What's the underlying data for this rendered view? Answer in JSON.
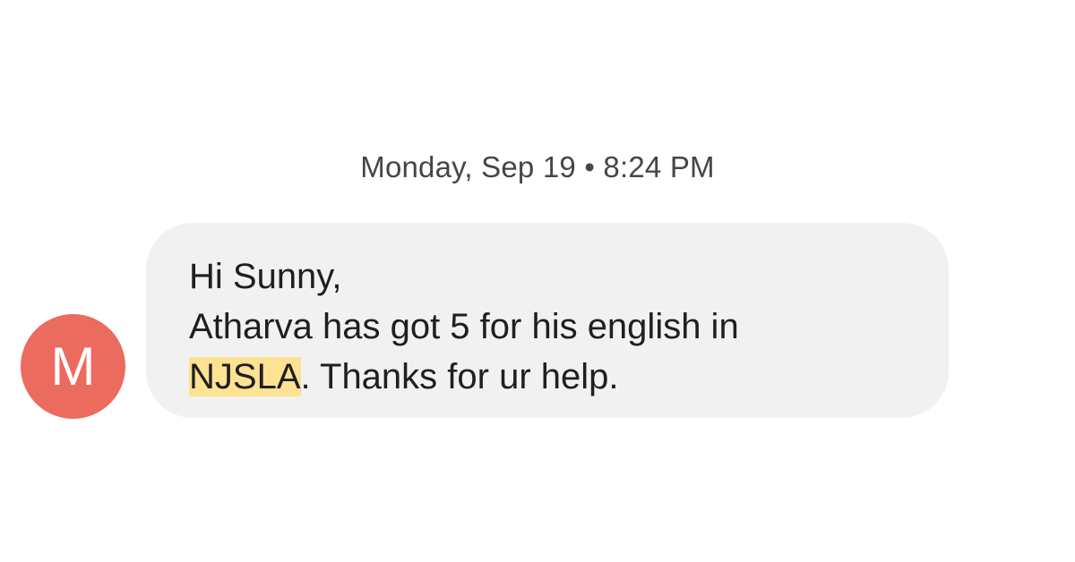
{
  "conversation": {
    "timestamp": "Monday, Sep 19 • 8:24 PM",
    "sender": {
      "avatar_letter": "M",
      "avatar_color": "#ec6b5f"
    },
    "message": {
      "line1": "Hi Sunny,",
      "line2": "Atharva has got 5 for his english in",
      "line3_highlight": "NJSLA",
      "line3_rest": ". Thanks for ur help."
    },
    "colors": {
      "bubble_background": "#f1f1f1",
      "highlight": "#fde293"
    }
  }
}
